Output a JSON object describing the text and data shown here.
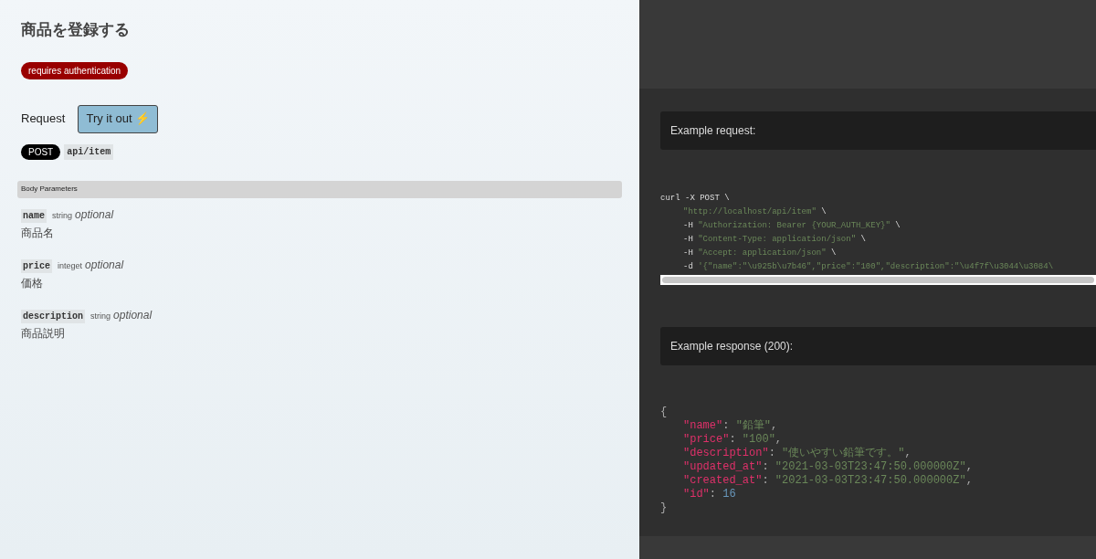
{
  "title": "商品を登録する",
  "auth_badge": "requires authentication",
  "request": {
    "label": "Request",
    "try_button": "Try it out ⚡",
    "method": "POST",
    "path": "api/item"
  },
  "body_parameters": {
    "heading": "Body Parameters",
    "params": [
      {
        "name": "name",
        "type": "string",
        "optional": "optional",
        "description": "商品名"
      },
      {
        "name": "price",
        "type": "integet",
        "optional": "optional",
        "description": "価格"
      },
      {
        "name": "description",
        "type": "string",
        "optional": "optional",
        "description": "商品説明"
      }
    ]
  },
  "example_request": {
    "heading": "Example request:",
    "command": "curl -X POST \\",
    "args": [
      [
        {
          "text": "\"http://localhost/api/item\"",
          "kind": "string"
        },
        {
          "text": " \\",
          "kind": "plain"
        }
      ],
      [
        {
          "text": "-H ",
          "kind": "plain"
        },
        {
          "text": "\"Authorization: Bearer {YOUR_AUTH_KEY}\"",
          "kind": "string"
        },
        {
          "text": " \\",
          "kind": "plain"
        }
      ],
      [
        {
          "text": "-H ",
          "kind": "plain"
        },
        {
          "text": "\"Content-Type: application/json\"",
          "kind": "string"
        },
        {
          "text": " \\",
          "kind": "plain"
        }
      ],
      [
        {
          "text": "-H ",
          "kind": "plain"
        },
        {
          "text": "\"Accept: application/json\"",
          "kind": "string"
        },
        {
          "text": " \\",
          "kind": "plain"
        }
      ],
      [
        {
          "text": "-d ",
          "kind": "plain"
        },
        {
          "text": "'{\"name\":\"\\u925b\\u7b46\",\"price\":\"100\",\"description\":\"\\u4f7f\\u3044\\u3084\\",
          "kind": "string"
        }
      ]
    ]
  },
  "example_response": {
    "heading": "Example response (200):",
    "open": "{",
    "close": "}",
    "entries": [
      [
        {
          "text": "\"name\"",
          "kind": "key"
        },
        {
          "text": ": ",
          "kind": "plain"
        },
        {
          "text": "\"鉛筆\"",
          "kind": "string"
        },
        {
          "text": ",",
          "kind": "plain"
        }
      ],
      [
        {
          "text": "\"price\"",
          "kind": "key"
        },
        {
          "text": ": ",
          "kind": "plain"
        },
        {
          "text": "\"100\"",
          "kind": "string"
        },
        {
          "text": ",",
          "kind": "plain"
        }
      ],
      [
        {
          "text": "\"description\"",
          "kind": "key"
        },
        {
          "text": ": ",
          "kind": "plain"
        },
        {
          "text": "\"使いやすい鉛筆です。\"",
          "kind": "string"
        },
        {
          "text": ",",
          "kind": "plain"
        }
      ],
      [
        {
          "text": "\"updated_at\"",
          "kind": "key"
        },
        {
          "text": ": ",
          "kind": "plain"
        },
        {
          "text": "\"2021-03-03T23:47:50.000000Z\"",
          "kind": "string"
        },
        {
          "text": ",",
          "kind": "plain"
        }
      ],
      [
        {
          "text": "\"created_at\"",
          "kind": "key"
        },
        {
          "text": ": ",
          "kind": "plain"
        },
        {
          "text": "\"2021-03-03T23:47:50.000000Z\"",
          "kind": "string"
        },
        {
          "text": ",",
          "kind": "plain"
        }
      ],
      [
        {
          "text": "\"id\"",
          "kind": "key"
        },
        {
          "text": ": ",
          "kind": "plain"
        },
        {
          "text": "16",
          "kind": "number"
        }
      ]
    ]
  }
}
